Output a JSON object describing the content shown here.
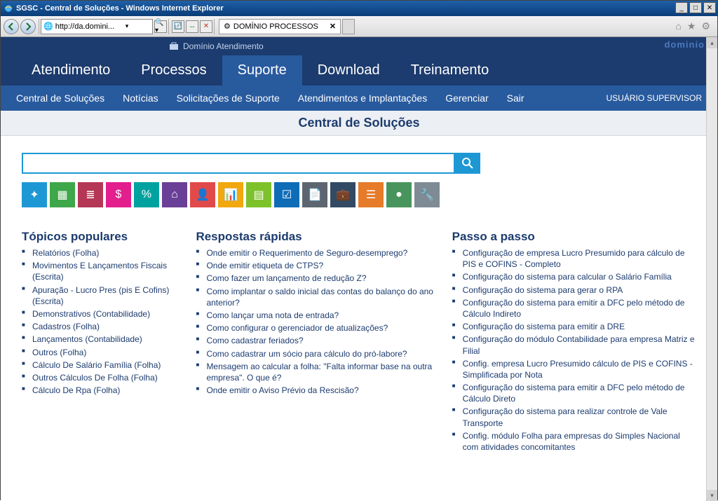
{
  "window": {
    "title": "SGSC - Central de Soluções - Windows Internet Explorer",
    "url_text": "http://da.domini...",
    "tab_label": "DOMÍNIO PROCESSOS"
  },
  "topband": {
    "label": "Domínio Atendimento",
    "brand": "dominio"
  },
  "mainmenu": [
    "Atendimento",
    "Processos",
    "Suporte",
    "Download",
    "Treinamento"
  ],
  "mainmenu_active": 2,
  "submenu": [
    "Central de Soluções",
    "Notícias",
    "Solicitações de Suporte",
    "Atendimentos e Implantações",
    "Gerenciar",
    "Sair"
  ],
  "user_label": "USUÁRIO SUPERVISOR",
  "page_title": "Central de Soluções",
  "search": {
    "placeholder": ""
  },
  "tiles": [
    {
      "color": "#1e98d5",
      "glyph": "✦",
      "name": "tile-1"
    },
    {
      "color": "#3ea749",
      "glyph": "▦",
      "name": "tile-calc"
    },
    {
      "color": "#b53756",
      "glyph": "≣",
      "name": "tile-docs"
    },
    {
      "color": "#e31f8d",
      "glyph": "$",
      "name": "tile-money"
    },
    {
      "color": "#00a2a0",
      "glyph": "%",
      "name": "tile-percent"
    },
    {
      "color": "#6a3f97",
      "glyph": "⌂",
      "name": "tile-home"
    },
    {
      "color": "#e14a4a",
      "glyph": "👤",
      "name": "tile-user"
    },
    {
      "color": "#f0a80c",
      "glyph": "📊",
      "name": "tile-chart"
    },
    {
      "color": "#7ec22b",
      "glyph": "▤",
      "name": "tile-book"
    },
    {
      "color": "#0f6db8",
      "glyph": "☑",
      "name": "tile-check"
    },
    {
      "color": "#5d6670",
      "glyph": "📄",
      "name": "tile-file"
    },
    {
      "color": "#324a63",
      "glyph": "💼",
      "name": "tile-briefcase"
    },
    {
      "color": "#e67b2a",
      "glyph": "☰",
      "name": "tile-list"
    },
    {
      "color": "#47955d",
      "glyph": "●",
      "name": "tile-dot"
    },
    {
      "color": "#7e8b95",
      "glyph": "🔧",
      "name": "tile-tool"
    }
  ],
  "columns": {
    "topicos": {
      "title": "Tópicos populares",
      "items": [
        "Relatórios (Folha)",
        "Movimentos E Lançamentos Fiscais (Escrita)",
        "Apuração - Lucro Pres (pis E Cofins) (Escrita)",
        "Demonstrativos (Contabilidade)",
        "Cadastros (Folha)",
        "Lançamentos (Contabilidade)",
        "Outros (Folha)",
        "Cálculo De Salário Família (Folha)",
        "Outros Cálculos De Folha (Folha)",
        "Cálculo De Rpa (Folha)"
      ]
    },
    "respostas": {
      "title": "Respostas rápidas",
      "items": [
        "Onde emitir o Requerimento de Seguro-desemprego?",
        "Onde emitir etiqueta de CTPS?",
        "Como fazer um lançamento de redução Z?",
        "Como implantar o saldo inicial das contas do balanço do ano anterior?",
        "Como lançar uma nota de entrada?",
        "Como configurar o gerenciador de atualizações?",
        "Como cadastrar feriados?",
        "Como cadastrar um sócio para cálculo do pró-labore?",
        "Mensagem ao calcular a folha: \"Falta informar base na outra empresa\". O que é?",
        "Onde emitir o Aviso Prévio da Rescisão?"
      ]
    },
    "passo": {
      "title": "Passo a passo",
      "items": [
        "Configuração de empresa Lucro Presumido para cálculo de PIS e COFINS - Completo",
        "Configuração do sistema para calcular o Salário Família",
        "Configuração do sistema para gerar o RPA",
        "Configuração do sistema para emitir a DFC pelo método de Cálculo Indireto",
        "Configuração do sistema para emitir a DRE",
        "Configuração do módulo Contabilidade para empresa Matriz e Filial",
        "Config. empresa Lucro Presumido cálculo de PIS e COFINS - Simplificada por Nota",
        "Configuração do sistema para emitir a DFC pelo método de Cálculo Direto",
        "Configuração do sistema para realizar controle de Vale Transporte",
        "Config. módulo Folha para empresas do Simples Nacional com atividades concomitantes"
      ]
    }
  }
}
